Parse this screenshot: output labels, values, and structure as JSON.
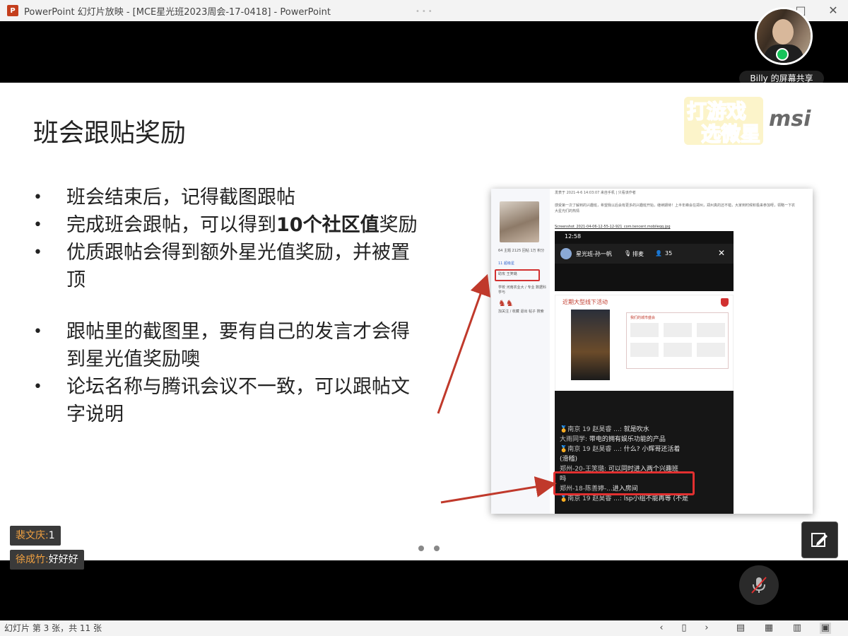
{
  "window": {
    "app_icon": "P",
    "title": "PowerPoint 幻灯片放映 - [MCE星光班2023周会-17-0418] - PowerPoint",
    "restore_glyph": "□",
    "close_glyph": "✕"
  },
  "meeting": {
    "share_label": "Billy 的屏幕共享",
    "chat_messages": [
      {
        "name": "裴文庆:",
        "text": "1"
      },
      {
        "name": "徐成竹:",
        "text": "好好好"
      }
    ]
  },
  "slide": {
    "title": "班会跟贴奖励",
    "logo_game_line1": "打游戏",
    "logo_game_line2": "选微星",
    "logo_msi": "msi",
    "bullets": [
      {
        "text": "班会结束后，记得截图跟帖"
      },
      {
        "text": "完成班会跟帖，可以得到",
        "bold": "10个社区值",
        "after": "奖励"
      },
      {
        "text": "优质跟帖会得到额外星光值奖励，并被置顶"
      },
      {
        "text": "跟帖里的截图里，要有自己的发言才会得到星光值奖励噢"
      },
      {
        "text": "论坛名称与腾讯会议不一致，可以跟帖文字说明"
      }
    ],
    "bullet_glyph": "•",
    "screenshot": {
      "side_stats": "64 主题  2125 回帖  1万 积分",
      "side_group": "11 超级星",
      "side_tags": "助攻    王笑璐",
      "side_lines": "学校  河南农业大 / 专业  数据科学与",
      "side_footer": "加关注 / 收藏 退出 帖子 搜索",
      "top_meta": "发表于 2021-4-6 14:03:07 来自手机 | 只看该作者",
      "paragraph": "感受第一次了解到的兴趣班，希望我以后会有更多的兴趣班开始，继续期待！上半年峰会在郑州，郑州真的还不错，大家到时候积极来参加呀，领略一下农大星光们的热情",
      "file_line": "Screenshot_2021-04-06-12-55-12-921_com.tencent.mobileqq.jpg",
      "phone_time": "12:58",
      "phone_room": "星光班-孙一帆",
      "phone_rank": "排麦",
      "phone_count": "35",
      "phone_close": "✕",
      "poster_title": "近期大型线下活动",
      "poster_sub": "我们的城市盛会",
      "chat_lines": [
        {
          "name": "🏅南京 19 赵昊睿 ...:",
          "msg": "就是吹水"
        },
        {
          "name": "大雨同学:",
          "msg": "带电的拥有娱乐功能的产品"
        },
        {
          "name": "🏅南京 19 赵昊睿 ...:",
          "msg": "什么? 小辉哥还活着"
        },
        {
          "name": "",
          "msg": "(滑稽)"
        },
        {
          "name": "郑州-20-王笑璐:",
          "msg": "可以同时进入两个兴趣班"
        },
        {
          "name": "",
          "msg": "吗"
        },
        {
          "name": "郑州-18-陈善婷-...",
          "msg": "进入房间"
        },
        {
          "name": "🏅南京 19 赵昊睿 ...:",
          "msg": "lsp小组不能再等 (不是"
        }
      ]
    }
  },
  "status": {
    "slide_counter": "幻灯片 第 3 张，共 11 张"
  },
  "colors": {
    "accent_red": "#c0392b",
    "logo_purple": "#7b3fb6",
    "logo_yellow": "#f5d52a"
  }
}
